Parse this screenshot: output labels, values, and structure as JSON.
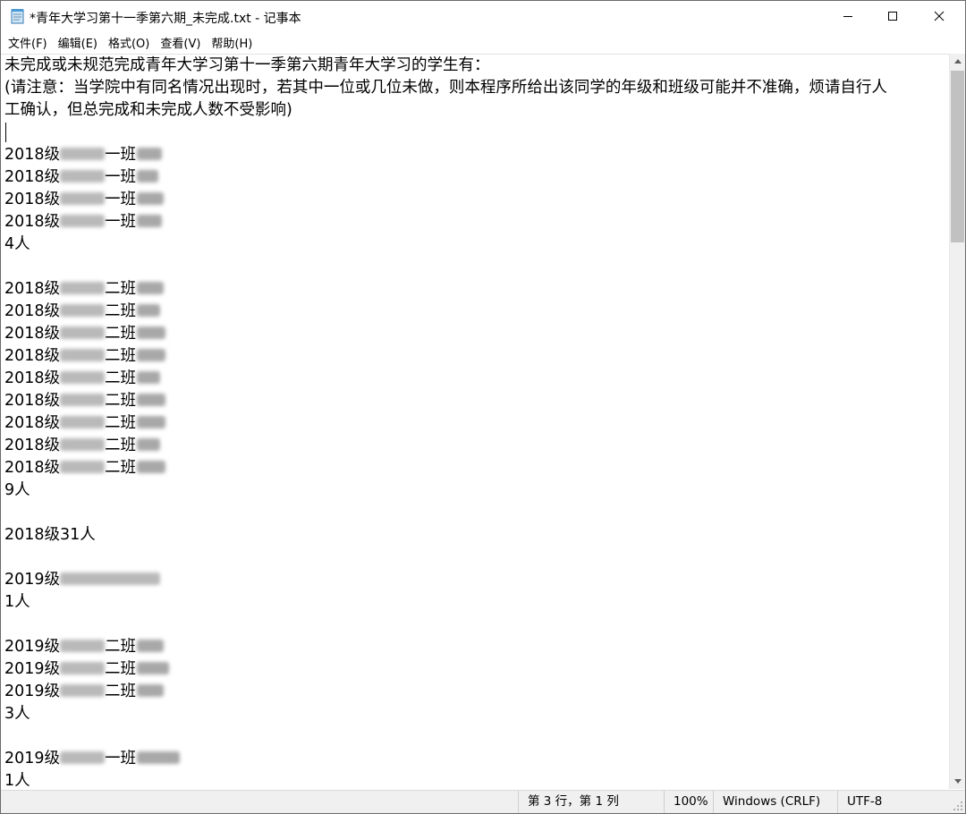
{
  "window": {
    "title": "*青年大学习第十一季第六期_未完成.txt - 记事本",
    "icon": "notepad-icon"
  },
  "menu": [
    "文件(F)",
    "编辑(E)",
    "格式(O)",
    "查看(V)",
    "帮助(H)"
  ],
  "document": {
    "lines": [
      {
        "text": "未完成或未规范完成青年大学习第十一季第六期青年大学习的学生有："
      },
      {
        "text": "(请注意：当学院中有同名情况出现时，若其中一位或几位未做，则本程序所给出该同学的年级和班级可能并不准确，烦请自行人"
      },
      {
        "text": "工确认，但总完成和未完成人数不受影响)"
      },
      {
        "text": ""
      },
      {
        "text": "2018级",
        "blur": [
          50,
          0,
          28
        ],
        "mid": "一班"
      },
      {
        "text": "2018级",
        "blur": [
          50,
          0,
          24
        ],
        "mid": "一班"
      },
      {
        "text": "2018级",
        "blur": [
          50,
          0,
          30
        ],
        "mid": "一班"
      },
      {
        "text": "2018级",
        "blur": [
          50,
          0,
          28
        ],
        "mid": "一班"
      },
      {
        "text": "4人"
      },
      {
        "text": ""
      },
      {
        "text": "2018级",
        "blur": [
          50,
          0,
          30
        ],
        "mid": "二班"
      },
      {
        "text": "2018级",
        "blur": [
          50,
          0,
          26
        ],
        "mid": "二班"
      },
      {
        "text": "2018级",
        "blur": [
          50,
          0,
          32
        ],
        "mid": "二班"
      },
      {
        "text": "2018级",
        "blur": [
          50,
          0,
          32
        ],
        "mid": "二班"
      },
      {
        "text": "2018级",
        "blur": [
          50,
          0,
          26
        ],
        "mid": "二班"
      },
      {
        "text": "2018级",
        "blur": [
          50,
          0,
          32
        ],
        "mid": "二班"
      },
      {
        "text": "2018级",
        "blur": [
          50,
          0,
          32
        ],
        "mid": "二班"
      },
      {
        "text": "2018级",
        "blur": [
          50,
          0,
          26
        ],
        "mid": "二班"
      },
      {
        "text": "2018级",
        "blur": [
          50,
          0,
          32
        ],
        "mid": "二班"
      },
      {
        "text": "9人"
      },
      {
        "text": ""
      },
      {
        "text": "2018级31人"
      },
      {
        "text": ""
      },
      {
        "text": "2019级",
        "blur": [
          112,
          0,
          0
        ]
      },
      {
        "text": "1人"
      },
      {
        "text": ""
      },
      {
        "text": "2019级",
        "blur": [
          50,
          0,
          30
        ],
        "mid": "二班"
      },
      {
        "text": "2019级",
        "blur": [
          50,
          0,
          36
        ],
        "mid": "二班"
      },
      {
        "text": "2019级",
        "blur": [
          50,
          0,
          30
        ],
        "mid": "二班"
      },
      {
        "text": "3人"
      },
      {
        "text": ""
      },
      {
        "text": "2019级",
        "blur": [
          50,
          0,
          48
        ],
        "mid": "一班"
      },
      {
        "text": "1人"
      }
    ]
  },
  "status": {
    "position": "第 3 行，第 1 列",
    "zoom": "100%",
    "line_ending": "Windows (CRLF)",
    "encoding": "UTF-8"
  }
}
